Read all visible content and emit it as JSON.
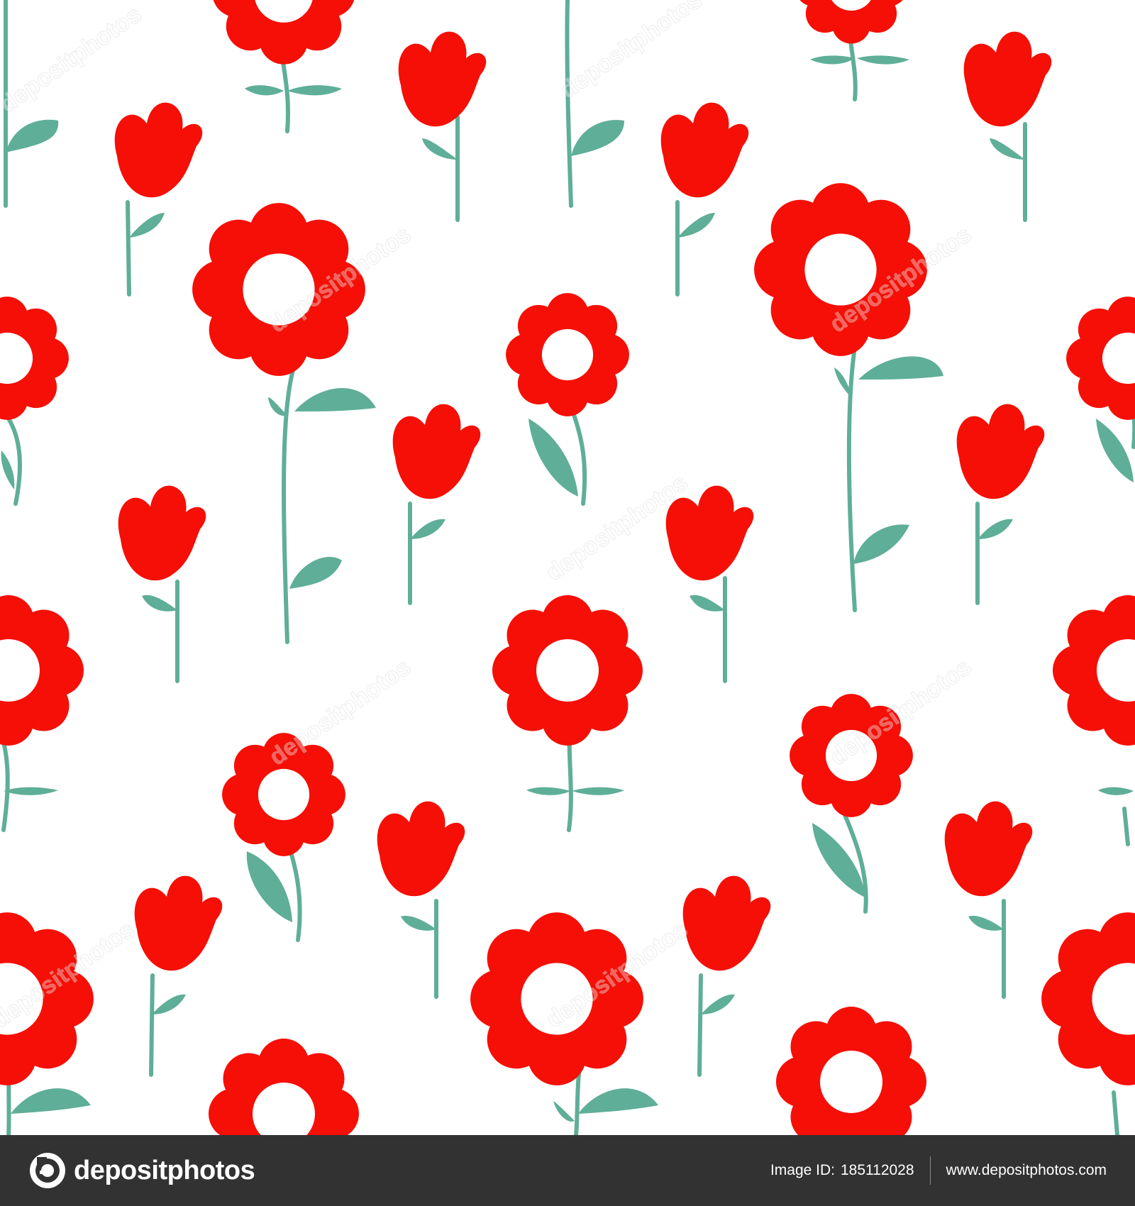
{
  "image": {
    "subject": "seamless-pattern-red-flowers",
    "colors": {
      "background": "#ffffff",
      "petal": "#f50f06",
      "stem": "#5fae98",
      "footer": "#323232"
    }
  },
  "footer": {
    "brand": "depositphotos",
    "image_id_label": "Image ID:",
    "image_id": "185112028",
    "site": "www.depositphotos.com"
  }
}
